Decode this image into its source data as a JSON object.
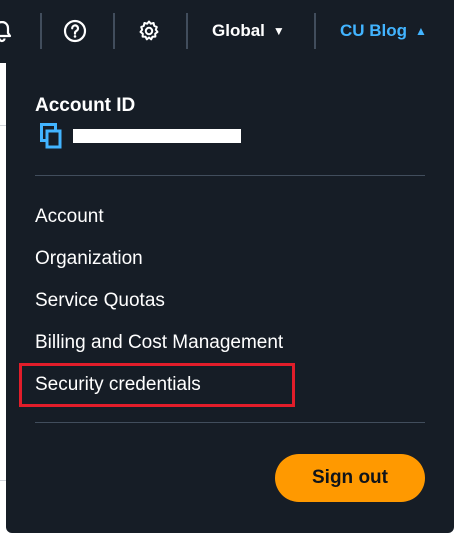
{
  "topbar": {
    "icons": [
      "bell-icon",
      "help-icon",
      "gear-icon"
    ],
    "region_label": "Global",
    "user_label": "CU Blog"
  },
  "menu": {
    "account_id_label": "Account ID",
    "items": [
      {
        "label": "Account"
      },
      {
        "label": "Organization"
      },
      {
        "label": "Service Quotas"
      },
      {
        "label": "Billing and Cost Management"
      },
      {
        "label": "Security credentials"
      }
    ],
    "sign_out_label": "Sign out"
  },
  "colors": {
    "topbar_bg": "#161d26",
    "accent_blue": "#42b4ff",
    "sign_out_orange": "#ff9900",
    "highlight_red": "#e11d2a"
  }
}
